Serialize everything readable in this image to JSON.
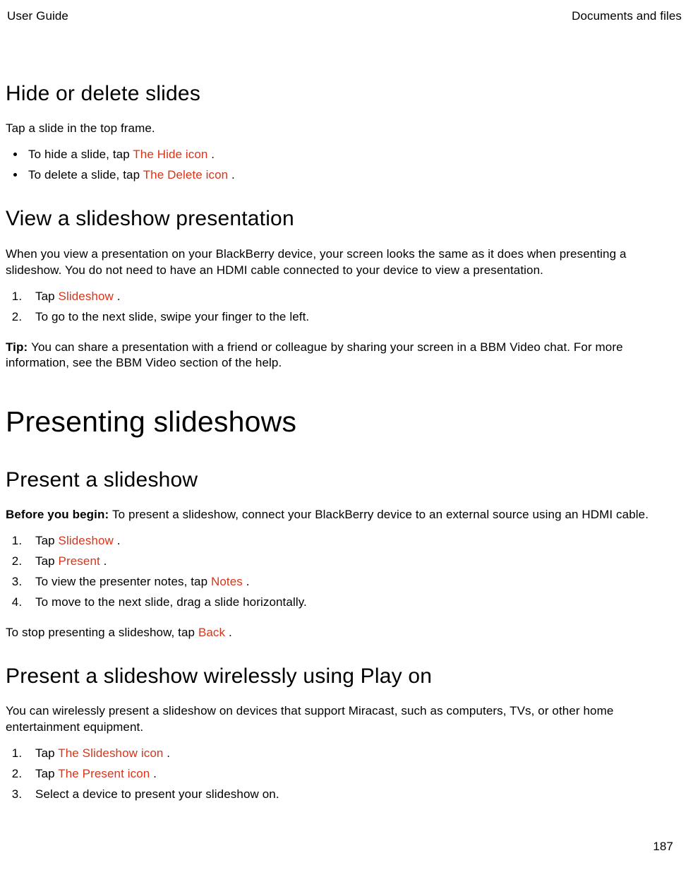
{
  "header": {
    "left": "User Guide",
    "right": "Documents and files"
  },
  "s1": {
    "title": "Hide or delete slides",
    "intro": "Tap a slide in the top frame.",
    "b1_pre": "To hide a slide, tap ",
    "b1_red": " The Hide icon ",
    "b1_post": ".",
    "b2_pre": "To delete a slide, tap ",
    "b2_red": " The Delete icon ",
    "b2_post": "."
  },
  "s2": {
    "title": "View a slideshow presentation",
    "intro": "When you view a presentation on your BlackBerry device, your screen looks the same as it does when presenting a slideshow. You do not need to have an HDMI cable connected to your device to view a presentation.",
    "n1_pre": "Tap ",
    "n1_red": " Slideshow ",
    "n1_post": ".",
    "n2": "To go to the next slide, swipe your finger to the left.",
    "tip_label": "Tip: ",
    "tip_body": "You can share a presentation with a friend or colleague by sharing your screen in a BBM Video chat. For more information, see the BBM Video section of the help."
  },
  "s3": {
    "title": "Presenting slideshows"
  },
  "s4": {
    "title": "Present a slideshow",
    "before_label": "Before you begin: ",
    "before_body": "To present a slideshow, connect your BlackBerry device to an external source using an HDMI cable.",
    "n1_pre": "Tap ",
    "n1_red": " Slideshow ",
    "n1_post": ".",
    "n2_pre": "Tap ",
    "n2_red": " Present ",
    "n2_post": ".",
    "n3_pre": "To view the presenter notes, tap ",
    "n3_red": " Notes ",
    "n3_post": ".",
    "n4": "To move to the next slide, drag a slide horizontally.",
    "stop_pre": "To stop presenting a slideshow, tap ",
    "stop_red": " Back ",
    "stop_post": "."
  },
  "s5": {
    "title": "Present a slideshow wirelessly using Play on",
    "intro": "You can wirelessly present a slideshow on devices that support Miracast, such as computers, TVs, or other home entertainment equipment.",
    "n1_pre": "Tap ",
    "n1_red": " The Slideshow icon ",
    "n1_post": ".",
    "n2_pre": "Tap ",
    "n2_red": " The Present icon ",
    "n2_post": ".",
    "n3": "Select a device to present your slideshow on."
  },
  "page_number": "187"
}
